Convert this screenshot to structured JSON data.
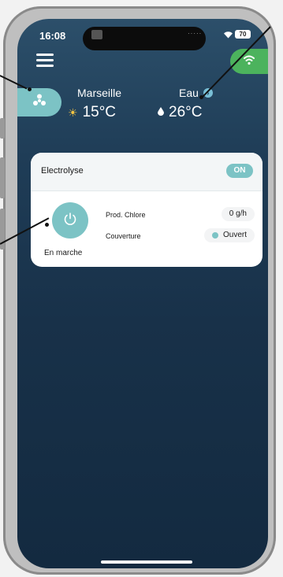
{
  "status_bar": {
    "time": "16:08",
    "signal_dots": "·····",
    "battery": "70"
  },
  "location": {
    "city": "Marseille",
    "air_temp": "15°C"
  },
  "water": {
    "label": "Eau",
    "temp": "26°C"
  },
  "card": {
    "title": "Electrolyse",
    "toggle_label": "ON",
    "state_label": "En marche",
    "rows": [
      {
        "label": "Prod. Chlore",
        "value": "0 g/h"
      },
      {
        "label": "Couverture",
        "value": "Ouvert"
      }
    ]
  },
  "colors": {
    "accent": "#7cc3c5",
    "connect": "#4cb35d",
    "background_top": "#2c4f6a",
    "background_bottom": "#132a40"
  },
  "icons": {
    "menu": "hamburger-menu-icon",
    "connect": "wifi-icon",
    "device": "fan-icon",
    "sun": "sun-icon",
    "drop": "water-drop-icon",
    "info": "chevron-right-icon",
    "power": "power-icon"
  }
}
